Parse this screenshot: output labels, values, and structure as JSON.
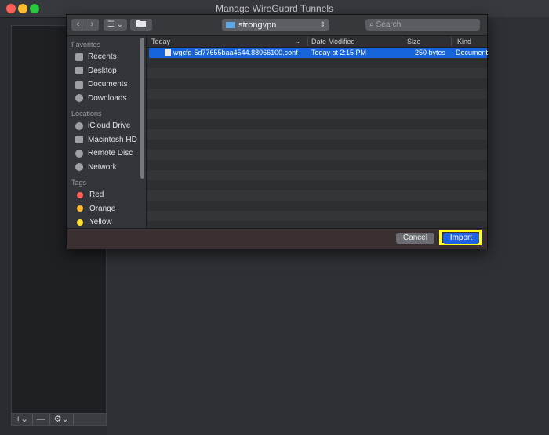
{
  "window": {
    "title": "Manage WireGuard Tunnels"
  },
  "outer_toolbar": {
    "add_label": "+",
    "add_chevron": "⌄",
    "remove_label": "—",
    "gear_label": "⚙",
    "gear_chevron": "⌄"
  },
  "sheet": {
    "toolbar": {
      "back_label": "‹",
      "forward_label": "›",
      "view_label": "☰ ⌄",
      "location": "strongvpn",
      "search_placeholder": "Search"
    },
    "sidebar": {
      "favorites_heading": "Favorites",
      "favorites": [
        "Recents",
        "Desktop",
        "Documents",
        "Downloads"
      ],
      "locations_heading": "Locations",
      "locations": [
        "iCloud Drive",
        "Macintosh HD",
        "Remote Disc",
        "Network"
      ],
      "tags_heading": "Tags",
      "tags": [
        {
          "label": "Red",
          "color": "#ff5f57"
        },
        {
          "label": "Orange",
          "color": "#febc2e"
        },
        {
          "label": "Yellow",
          "color": "#ffe033"
        }
      ]
    },
    "columns": {
      "name": "Today",
      "date": "Date Modified",
      "size": "Size",
      "kind": "Kind"
    },
    "files": [
      {
        "name": "wgcfg-5d77655baa4544.88066100.conf",
        "date": "Today at 2:15 PM",
        "size": "250 bytes",
        "kind": "Document"
      }
    ],
    "footer": {
      "cancel_label": "Cancel",
      "import_label": "Import",
      "highlight_color": "#ffff1a"
    }
  }
}
